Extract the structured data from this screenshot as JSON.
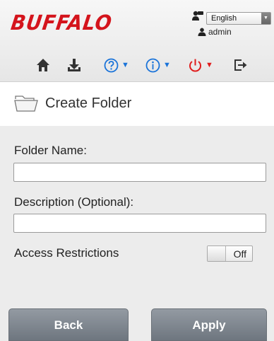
{
  "brand": {
    "logo_text": "BUFFALO",
    "logo_color": "#d4141c"
  },
  "language": {
    "selected": "English"
  },
  "user": {
    "name": "admin"
  },
  "toolbar": {
    "icons": [
      "home-icon",
      "download-icon",
      "help-icon",
      "info-icon",
      "power-icon",
      "logout-icon"
    ],
    "accent_blue": "#1a73d9",
    "accent_red": "#e01c1c"
  },
  "page": {
    "title": "Create Folder",
    "title_icon": "folder-icon"
  },
  "form": {
    "folder_name_label": "Folder Name:",
    "folder_name_value": "",
    "description_label": "Description (Optional):",
    "description_value": "",
    "access_label": "Access Restrictions",
    "access_state": "Off"
  },
  "buttons": {
    "back": "Back",
    "apply": "Apply"
  }
}
